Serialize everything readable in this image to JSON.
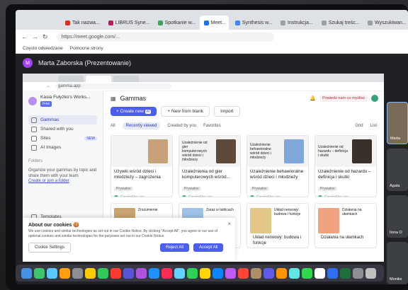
{
  "outer_browser": {
    "tabs": [
      {
        "label": "Tak nazwa...",
        "color": "#d93025"
      },
      {
        "label": "LIBRUS Syne...",
        "color": "#c2185b"
      },
      {
        "label": "Spotkanie w...",
        "color": "#34a853"
      },
      {
        "label": "Meet...",
        "color": "#1a73e8",
        "active": true
      },
      {
        "label": "Synthesis w...",
        "color": "#4285f4"
      },
      {
        "label": "Instrukcja...",
        "color": "#9aa0a6"
      },
      {
        "label": "Szukaj treśc...",
        "color": "#9aa0a6"
      },
      {
        "label": "Wyszukiwan...",
        "color": "#9aa0a6"
      }
    ],
    "url": "https://meet.google.com/...",
    "bookmarks": [
      "Często odwiedzane",
      "Pomocne strony"
    ]
  },
  "meet": {
    "presenter_initial": "M",
    "presenter_title": "Marta Zaborska (Prezentowanie)",
    "participants": [
      "Marta",
      "Agata",
      "Ilona O",
      "Moniks"
    ]
  },
  "shared": {
    "url": "gamma.app",
    "workspace": {
      "name": "Kasia Fułyżko's Works...",
      "badge": "Free"
    },
    "nav": [
      {
        "label": "Gammas",
        "icon": "gammas-icon",
        "selected": true
      },
      {
        "label": "Shared with you",
        "icon": "shared-icon"
      },
      {
        "label": "Sites",
        "icon": "sites-icon",
        "badge": "NEW"
      },
      {
        "label": "AI Images",
        "icon": "ai-images-icon"
      }
    ],
    "folders_label": "Folders",
    "folders_text": "Organize your gammas by topic and share them with your team",
    "folders_link": "Create or join a folder",
    "bottom_nav": [
      {
        "label": "Templates",
        "icon": "templates-icon"
      },
      {
        "label": "Inspiration",
        "icon": "inspiration-icon"
      }
    ],
    "page_title": "Gammas",
    "create_button": "+ Create new",
    "create_badge": "AI",
    "blank_button": "+ New from blank",
    "import_button": "Import",
    "feedback": "Powiedz nam co myślisz",
    "chips": [
      "All",
      "Recently viewed",
      "Created by you",
      "Favorites"
    ],
    "view_grid": "Grid",
    "view_list": "List",
    "cards": [
      {
        "title": "Używki wśród dzieci i młodzieży – zagrożenia dla...",
        "tag": "Prywatne",
        "by": "Created by you",
        "thumb": "",
        "thumb_color": "#c7a17a"
      },
      {
        "title": "Uzależnienia od gier komputerowych wśród...",
        "tag": "Prywatne",
        "by": "Created by you",
        "thumb": "Uzależnienie od gier komputerowych wśród dzieci i młodzieży",
        "thumb_color": "#5d4a3a"
      },
      {
        "title": "Uzależnienie behawioralne wśród dzieci i młodzieży",
        "tag": "Prywatne",
        "by": "Created by you",
        "thumb": "Uzależnienie behawioralne wśród dzieci i młodzieży",
        "thumb_color": "#7fa7d9"
      },
      {
        "title": "Uzależnienie od hazardu – definicja i skutki",
        "tag": "Prywatne",
        "by": "Created by you",
        "thumb": "Uzależnienie od hazardu – definicja i skutki",
        "thumb_color": "#3b2f2a"
      }
    ],
    "cards_row2": [
      {
        "title": "",
        "thumb_color": "#caa46e",
        "thumb": "Zrozumienie"
      },
      {
        "title": "dzona – nowoczesno...",
        "thumb_color": "#9fc3e6",
        "thumb": "Zaraz w tablicach"
      },
      {
        "title": "Układ nerwowy: budowa i funkcje",
        "thumb_color": "#e4c686",
        "thumb": "Układ nerwowy: budowa i funkcje"
      },
      {
        "title": "Działania na ułamkach",
        "thumb_color": "#f0a37e",
        "thumb": "Działania na ułamkach"
      }
    ],
    "cookie": {
      "title": "About our cookies 🍪",
      "text": "We use cookies and similar technologies as set out in our Cookie Notice. By clicking \"Accept All\", you agree to our use of optional cookies and similar technologies for the purposes set out in our Cookie Notice.",
      "settings": "Cookie Settings",
      "reject": "Reject All",
      "accept": "Accept All"
    }
  },
  "dock_colors": [
    "#4a90e2",
    "#3ec46d",
    "#5ac8fa",
    "#ff9f0a",
    "#8e8e93",
    "#ffcc00",
    "#34c759",
    "#ff3b30",
    "#5856d6",
    "#af52de",
    "#1e90ff",
    "#ff2d55",
    "#64d2ff",
    "#30d158",
    "#ffd60a",
    "#0a84ff",
    "#bf5af2",
    "#ff453a",
    "#ac8e68",
    "#5e5ce6",
    "#ff9500",
    "#63e6e2",
    "#32d74b",
    "#ffffff",
    "#2f6fed",
    "#1f6f3a",
    "#8e8e93",
    "#c0c0c0"
  ]
}
